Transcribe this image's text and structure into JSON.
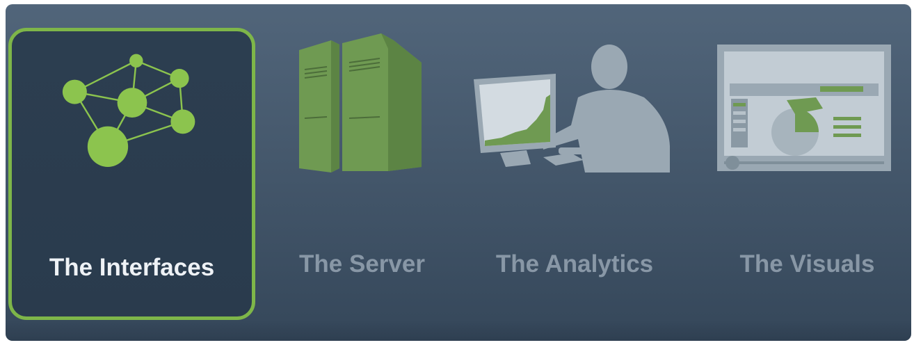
{
  "tabs": [
    {
      "label": "The Interfaces",
      "icon": "network-nodes-icon",
      "selected": true
    },
    {
      "label": "The Server",
      "icon": "server-towers-icon",
      "selected": false
    },
    {
      "label": "The Analytics",
      "icon": "analyst-at-monitor-icon",
      "selected": false
    },
    {
      "label": "The Visuals",
      "icon": "dashboard-screen-icon",
      "selected": false
    }
  ],
  "colors": {
    "accent_green": "#7eb649",
    "icon_green": "#8cc44e",
    "muted_green": "#6f9a52",
    "silhouette_gray": "#9aa8b3",
    "label_active": "#eef2f6",
    "label_inactive": "#8897a6"
  }
}
